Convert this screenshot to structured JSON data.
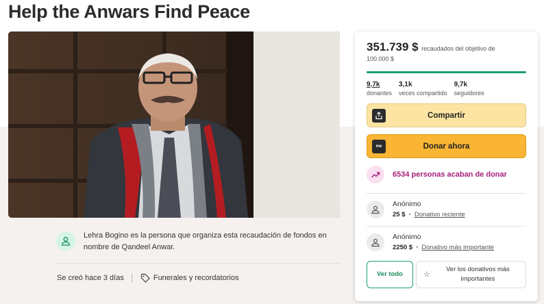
{
  "page": {
    "title": "Help the Anwars Find Peace"
  },
  "organizer": {
    "text": "Lehra Bogino es la persona que organiza esta recaudación de fondos en nombre de Qandeel Anwar."
  },
  "meta": {
    "created": "Se creó hace 3 días",
    "category": "Funerales y recordatorios"
  },
  "card": {
    "raised_amount": "351.739 $",
    "raised_text": "recaudados del objetivo de 100.000 $",
    "progress": 1.0,
    "stats": [
      {
        "value": "9,7k",
        "label": "donantes"
      },
      {
        "value": "3,1k",
        "label": "veces compartido"
      },
      {
        "value": "9,7k",
        "label": "seguidores"
      }
    ],
    "share_label": "Compartir",
    "donate_label": "Donar ahora",
    "donate_icon_text": "me",
    "recent_text": "6534 personas acaban de donar",
    "donations": [
      {
        "name": "Anónimo",
        "amount": "25 $",
        "type": "Donativo reciente"
      },
      {
        "name": "Anónimo",
        "amount": "2250 $",
        "type": "Donativo más importante"
      }
    ],
    "see_all_label": "Ver todo",
    "see_top_label": "Ver los donativos más importantes"
  },
  "colors": {
    "accent_green": "#1ba26a",
    "donate_orange": "#f9b533",
    "share_yellow": "#fde4a3",
    "recent_magenta": "#a51f7a"
  }
}
